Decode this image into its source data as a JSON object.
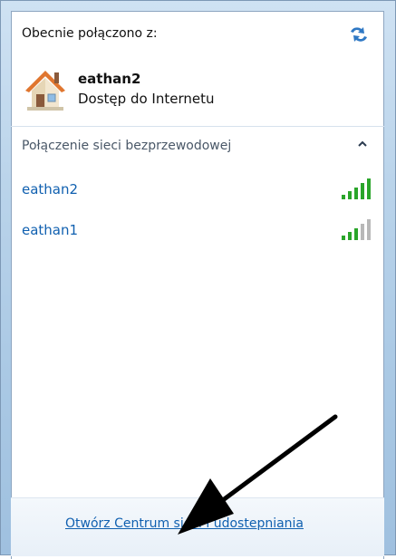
{
  "header": {
    "title": "Obecnie połączono z:",
    "refresh_icon": "refresh-network-icon"
  },
  "current_connection": {
    "icon": "home-network-icon",
    "name": "eathan2",
    "status": "Dostęp do Internetu"
  },
  "wireless_group": {
    "label": "Połączenie sieci bezprzewodowej",
    "collapse_icon": "chevron-up-icon",
    "networks": [
      {
        "name": "eathan2",
        "signal_bars": 5,
        "icon": "signal-strength-icon"
      },
      {
        "name": "eathan1",
        "signal_bars": 3,
        "icon": "signal-strength-icon"
      }
    ]
  },
  "footer": {
    "link_label": "Otwórz Centrum sieci i udostepniania"
  },
  "colors": {
    "link": "#1060b0",
    "signal_active": "#2aa52a",
    "signal_inactive": "#b8b8b8",
    "frame": "#b9d3ea"
  }
}
